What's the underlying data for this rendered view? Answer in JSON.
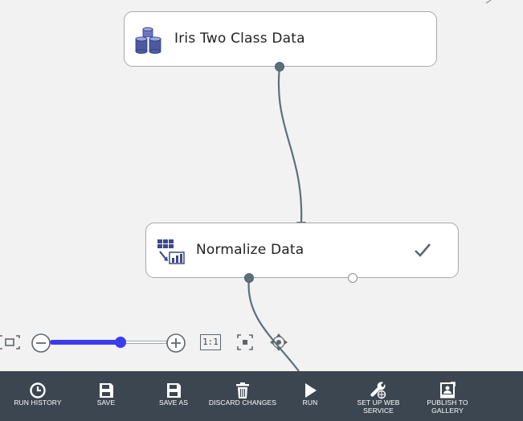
{
  "canvas": {
    "modules": [
      {
        "id": "iris",
        "label": "Iris Two Class Data",
        "icon": "dataset-icon"
      },
      {
        "id": "normalize",
        "label": "Normalize Data",
        "icon": "normalize-data-icon",
        "status_icon": "checkmark-icon"
      }
    ]
  },
  "zoom_controls": {
    "fit_icon": "fit-to-screen-icon",
    "zoom_out_icon": "zoom-out-icon",
    "zoom_in_icon": "zoom-in-icon",
    "slider_level": 0.6,
    "actual_size_label": "1:1",
    "minimap_icon": "minimap-icon",
    "pan_icon": "pan-icon"
  },
  "toolbar": {
    "items": [
      {
        "label": "RUN HISTORY",
        "icon": "clock-icon"
      },
      {
        "label": "SAVE",
        "icon": "save-icon"
      },
      {
        "label": "SAVE AS",
        "icon": "save-as-icon"
      },
      {
        "label": "DISCARD CHANGES",
        "icon": "trash-icon"
      },
      {
        "label": "RUN",
        "icon": "play-icon"
      },
      {
        "label": "SET UP WEB\nSERVICE",
        "icon": "wrench-globe-icon"
      },
      {
        "label": "PUBLISH TO\nGALLERY",
        "icon": "publish-gallery-icon"
      }
    ]
  },
  "colors": {
    "canvas_bg": "#f2f2f2",
    "toolbar_bg": "#3c4650",
    "slider_accent": "#3b3bf0",
    "port_color": "#5d6f7a",
    "wire_color": "#5d6f7a"
  }
}
